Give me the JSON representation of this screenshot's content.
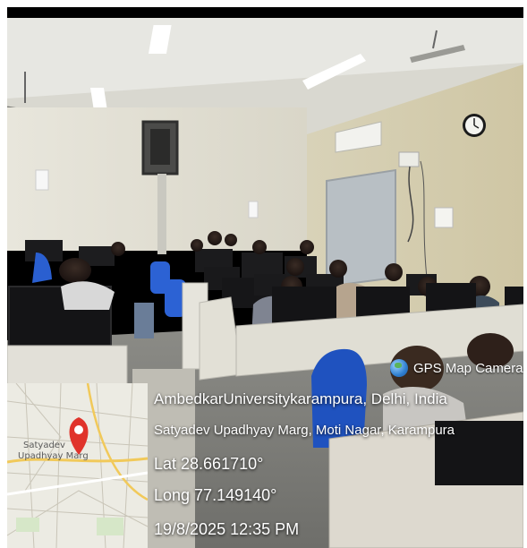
{
  "badge": {
    "title": "GPS Map Camera",
    "icon": "globe-icon"
  },
  "location": {
    "place": "AmbedkarUniversitykarampura, Delhi, India",
    "address": "Satyadev Upadhyay Marg, Moti Nagar, Karampura",
    "lat": "Lat 28.661710°",
    "long": "Long 77.149140°",
    "datetime": "19/8/2025 12:35 PM"
  },
  "map": {
    "label_1": "Satyadev",
    "label_2": "Upadhyay Marg",
    "pin_icon": "map-pin-icon"
  },
  "colors": {
    "pin": "#e0332b",
    "overlay_text": "#ffffff"
  }
}
